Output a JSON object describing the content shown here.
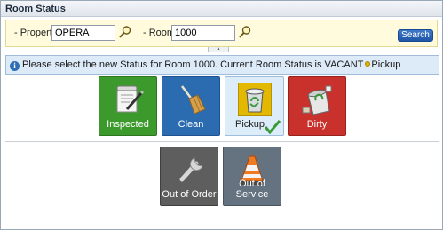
{
  "window": {
    "title": "Room Status"
  },
  "search": {
    "property_label": "- Property",
    "property_value": "OPERA",
    "room_label": "- Room",
    "room_value": "1000",
    "search_button": "Search"
  },
  "info": {
    "message": "Please select the new Status for Room 1000. Current Room Status is VACANT",
    "current_status": "Pickup"
  },
  "statuses": [
    {
      "label": "Inspected",
      "color": "#3c9a2c",
      "icon": "clipboard-pen-icon"
    },
    {
      "label": "Clean",
      "color": "#2b6cb0",
      "icon": "broom-icon"
    },
    {
      "label": "Pickup",
      "color": "#dcedf9",
      "icon": "trash-can-icon",
      "selected": true
    },
    {
      "label": "Dirty",
      "color": "#c8312c",
      "icon": "overflowing-bin-icon"
    }
  ],
  "secondary_statuses": [
    {
      "label": "Out of Order",
      "color": "#5e5e5e",
      "icon": "wrench-icon"
    },
    {
      "label": "Out of Service",
      "color": "#657381",
      "icon": "traffic-cone-icon"
    }
  ]
}
